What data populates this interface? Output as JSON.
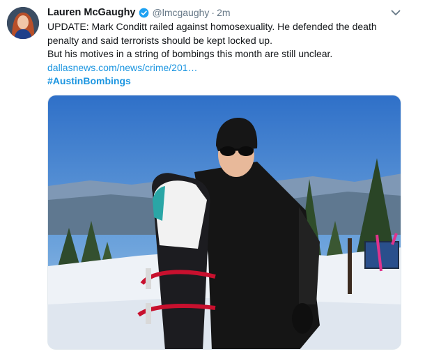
{
  "tweet": {
    "author_name": "Lauren McGaughy",
    "handle": "@lmcgaughy",
    "separator": "·",
    "time": "2m",
    "line1": "UPDATE: Mark Conditt railed against homosexuality. He defended the death",
    "line2": "penalty and said terrorists should be kept locked up.",
    "line3": "But his motives in a string of bombings this month are still unclear.",
    "link": "dallasnews.com/news/crime/201…",
    "hashtag": "#AustinBombings"
  },
  "icons": {
    "verified": "verified-badge-icon",
    "caret": "chevron-down-icon"
  },
  "colors": {
    "link": "#1b95e0",
    "secondary_text": "#657786",
    "sky": "#4f8ad0",
    "snow": "#f1f4f8"
  }
}
